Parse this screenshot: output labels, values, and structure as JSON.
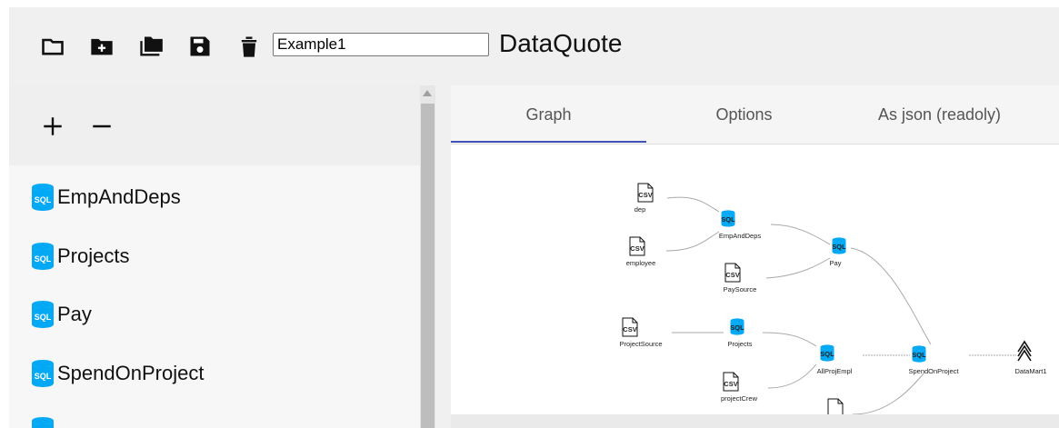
{
  "toolbar": {
    "buttons": [
      {
        "icon": "folder-open-icon"
      },
      {
        "icon": "folder-add-icon"
      },
      {
        "icon": "folders-copy-icon"
      },
      {
        "icon": "save-icon"
      },
      {
        "icon": "trash-icon"
      }
    ],
    "name_value": "Example1",
    "title": "DataQuote"
  },
  "left_panel": {
    "add_icon": "plus-icon",
    "remove_icon": "minus-icon",
    "items": [
      {
        "label": "EmpAndDeps",
        "icon": "sql-database-icon"
      },
      {
        "label": "Projects",
        "icon": "sql-database-icon"
      },
      {
        "label": "Pay",
        "icon": "sql-database-icon"
      },
      {
        "label": "SpendOnProject",
        "icon": "sql-database-icon"
      }
    ]
  },
  "tabs": [
    {
      "label": "Graph",
      "active": true
    },
    {
      "label": "Options",
      "active": false
    },
    {
      "label": "As json (readoly)",
      "active": false
    }
  ],
  "graph": {
    "nodes": {
      "dep": "dep",
      "employee": "employee",
      "emp_and_deps": "EmpAndDeps",
      "pay_source": "PaySource",
      "pay": "Pay",
      "project_source": "ProjectSource",
      "projects": "Projects",
      "all_proj_empl": "AllProjEmpl",
      "spend_on_project": "SpendOnProject",
      "data_mart": "DataMart1",
      "project_crew": "projectCrew"
    },
    "csv_label": "CSV",
    "sql_label": "SQL"
  },
  "colors": {
    "accent": "#3f51b5",
    "sql_icon": "#03a9f4"
  }
}
